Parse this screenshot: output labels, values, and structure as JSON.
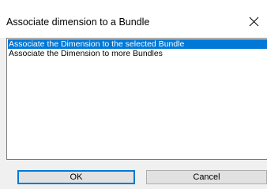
{
  "dialog": {
    "title": "Associate dimension to a Bundle",
    "close_icon": "close-icon"
  },
  "list": {
    "items": [
      {
        "label": "Associate the Dimension to the selected Bundle",
        "selected": true
      },
      {
        "label": "Associate the Dimension to more Bundles",
        "selected": false
      }
    ]
  },
  "buttons": {
    "ok_label": "OK",
    "cancel_label": "Cancel"
  },
  "colors": {
    "selection": "#0078d7",
    "dialog_bg": "#f0f0f0",
    "button_bg": "#e1e1e1"
  }
}
